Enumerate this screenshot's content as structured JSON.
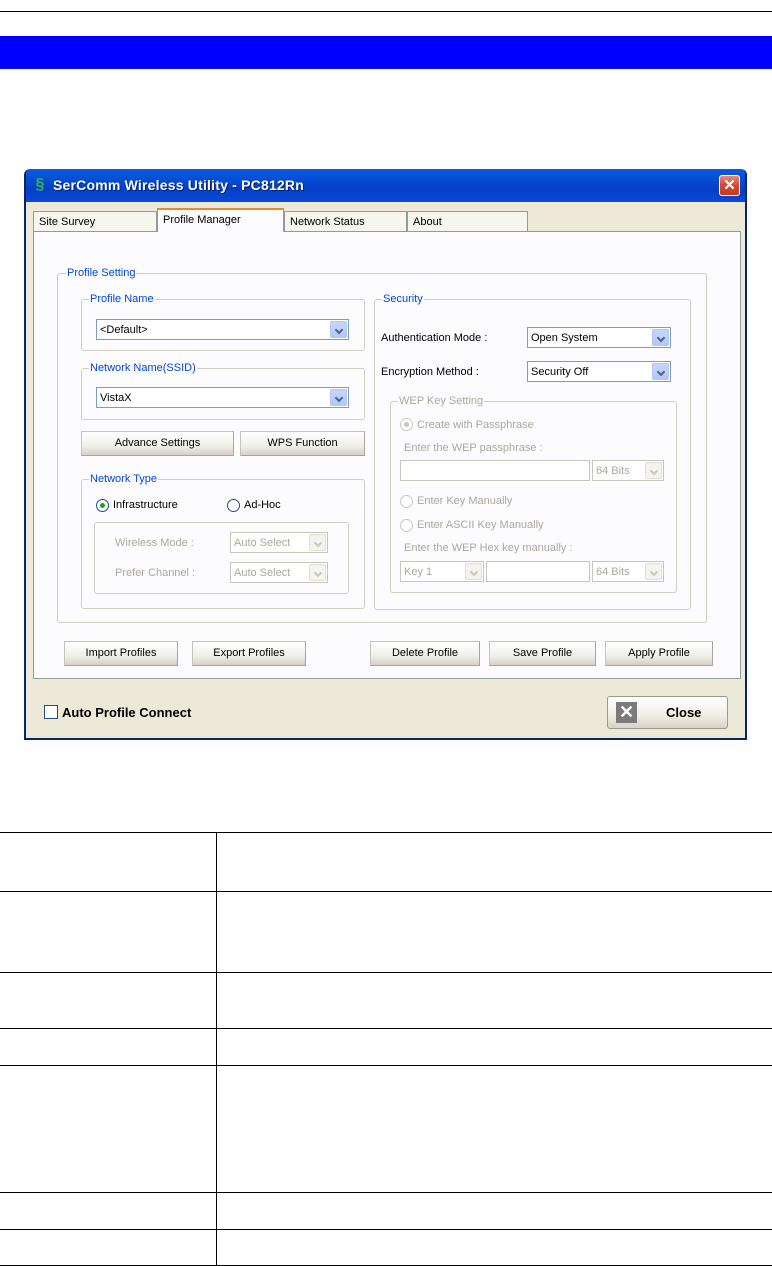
{
  "window": {
    "title": "SerComm Wireless Utility - PC812Rn",
    "tabs": [
      "Site Survey",
      "Profile Manager",
      "Network Status",
      "About"
    ],
    "active_tab": "Profile Manager"
  },
  "profile_setting": {
    "legend": "Profile Setting",
    "profile_name": {
      "legend": "Profile Name",
      "value": "<Default>"
    },
    "network_name": {
      "legend": "Network Name(SSID)",
      "value": "VistaX"
    },
    "advance_settings_label": "Advance Settings",
    "wps_function_label": "WPS Function",
    "network_type": {
      "legend": "Network Type",
      "infrastructure_label": "Infrastructure",
      "adhoc_label": "Ad-Hoc",
      "selected": "Infrastructure",
      "wireless_mode_label": "Wireless Mode :",
      "wireless_mode_value": "Auto Select",
      "prefer_channel_label": "Prefer Channel :",
      "prefer_channel_value": "Auto Select"
    },
    "security": {
      "legend": "Security",
      "auth_mode_label": "Authentication Mode :",
      "auth_mode_value": "Open System",
      "encryption_label": "Encryption Method :",
      "encryption_value": "Security Off",
      "wep": {
        "legend": "WEP Key Setting",
        "create_passphrase_label": "Create with Passphrase",
        "enter_passphrase_label": "Enter the WEP passphrase :",
        "passphrase_bits": "64 Bits",
        "enter_key_manually_label": "Enter Key Manually",
        "enter_ascii_label": "Enter ASCII Key Manually",
        "enter_hex_label": "Enter the WEP Hex key manually :",
        "key_index": "Key 1",
        "hex_bits": "64 Bits"
      }
    }
  },
  "actions": {
    "import_profiles": "Import Profiles",
    "export_profiles": "Export Profiles",
    "delete_profile": "Delete Profile",
    "save_profile": "Save Profile",
    "apply_profile": "Apply  Profile"
  },
  "auto_profile_connect_label": "Auto Profile Connect",
  "close_label": "Close"
}
